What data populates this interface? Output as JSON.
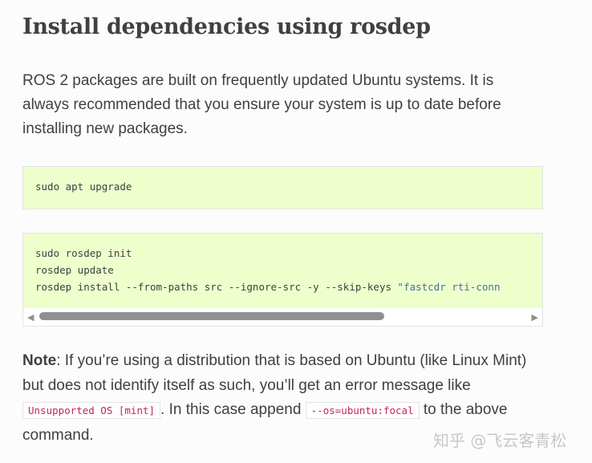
{
  "heading": "Install dependencies using rosdep",
  "intro": "ROS 2 packages are built on frequently updated Ubuntu systems. It is always recommended that you ensure your system is up to date before installing new packages.",
  "code1": [
    "sudo apt upgrade"
  ],
  "code2": {
    "line1": "sudo rosdep init",
    "line2": "rosdep update",
    "line3_cmd": "rosdep install --from-paths src --ignore-src -y --skip-keys ",
    "line3_str": "\"fastcdr rti-conn"
  },
  "note": {
    "label": "Note",
    "text1": ": If you’re using a distribution that is based on Ubuntu (like Linux Mint) but does not identify itself as such, you’ll get an error message like ",
    "code1": "Unsupported OS [mint]",
    "text2": ". In this case append ",
    "code2": "--os=ubuntu:focal",
    "text3": " to the above command."
  },
  "watermark": "知乎 @飞云客青松"
}
